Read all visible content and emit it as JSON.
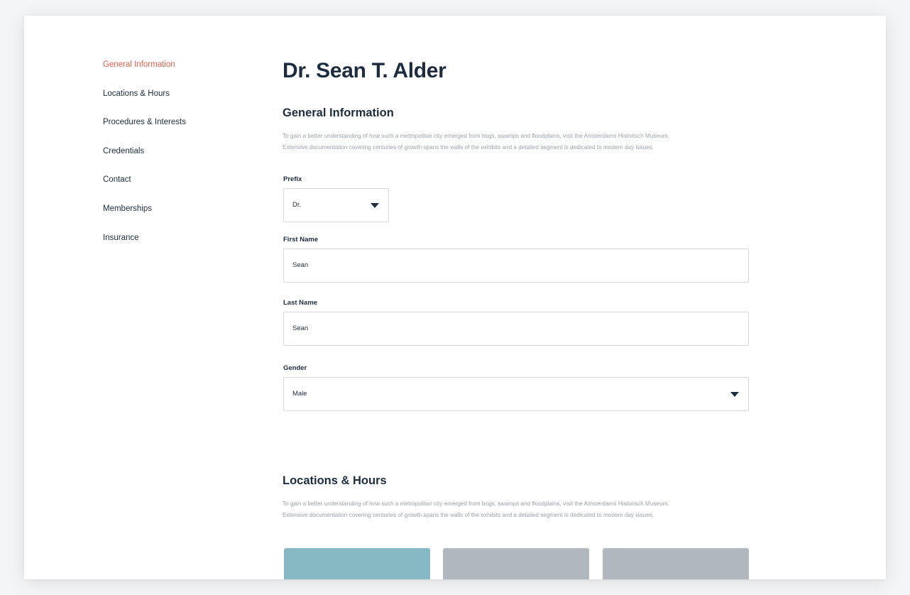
{
  "sidebar": {
    "items": [
      {
        "label": "General Information",
        "active": true
      },
      {
        "label": "Locations & Hours"
      },
      {
        "label": "Procedures & Interests"
      },
      {
        "label": "Credentials"
      },
      {
        "label": "Contact"
      },
      {
        "label": "Memberships"
      },
      {
        "label": "Insurance"
      }
    ]
  },
  "page": {
    "title": "Dr. Sean T. Alder"
  },
  "general": {
    "heading": "General Information",
    "desc_line1": "To gain a better understanding of how such a metropolitan city emerged from bogs, swamps and floodplains, visit the Amsterdams Historisch Museum.",
    "desc_line2": "Extensive documentation covering centuries of growth spans the walls of the exhibits and a detailed segment is dedicated to modern day issues,",
    "prefix": {
      "label": "Prefix",
      "value": "Dr."
    },
    "first_name": {
      "label": "First Name",
      "value": "Sean"
    },
    "last_name": {
      "label": "Last Name",
      "value": "Sean"
    },
    "gender": {
      "label": "Gender",
      "value": "Male"
    }
  },
  "locations": {
    "heading": "Locations & Hours",
    "desc_line1": "To gain a better understanding of how such a metropolitan city emerged from bogs, swamps and floodplains, visit the Amsterdams Historisch Museum.",
    "desc_line2": "Extensive documentation covering centuries of growth spans the walls of the exhibits and a detailed segment is dedicated to modern day issues,"
  },
  "colors": {
    "accent": "#e8604c",
    "text": "#1d2d3f",
    "tile_teal": "#86b9c3",
    "tile_gray": "#b0b7bf"
  }
}
